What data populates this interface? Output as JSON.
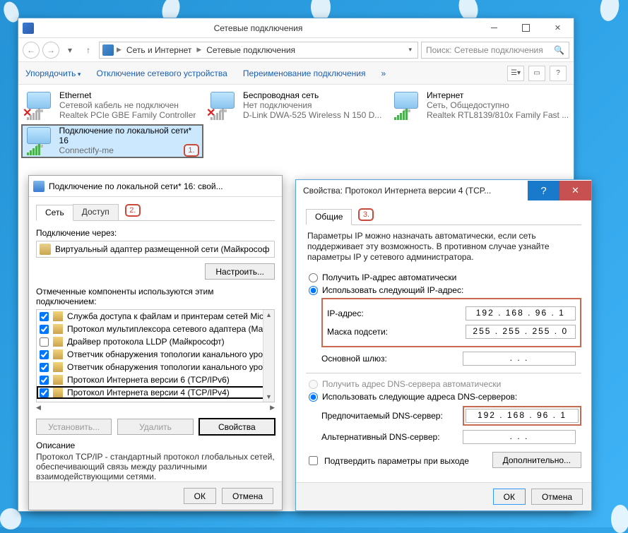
{
  "main": {
    "title": "Сетевые подключения",
    "breadcrumb": {
      "seg1": "Сеть и Интернет",
      "seg2": "Сетевые подключения"
    },
    "search_placeholder": "Поиск: Сетевые подключения",
    "toolbar": {
      "organize": "Упорядочить",
      "disable": "Отключение сетевого устройства",
      "rename": "Переименование подключения"
    },
    "connections": [
      {
        "name": "Ethernet",
        "status": "Сетевой кабель не подключен",
        "device": "Realtek PCIe GBE Family Controller",
        "disconnected": true
      },
      {
        "name": "Беспроводная сеть",
        "status": "Нет подключения",
        "device": "D-Link DWA-525 Wireless N 150 D...",
        "disconnected": true
      },
      {
        "name": "Интернет",
        "status": "Сеть, Общедоступно",
        "device": "Realtek RTL8139/810x Family Fast ...",
        "disconnected": false
      },
      {
        "name": "Подключение по локальной сети* 16",
        "status": "",
        "device": "Connectify-me",
        "disconnected": false,
        "selected": true
      }
    ]
  },
  "props": {
    "title": "Подключение по локальной сети* 16: свой...",
    "tabs": {
      "net": "Сеть",
      "access": "Доступ"
    },
    "connect_via_label": "Подключение через:",
    "adapter": "Виртуальный адаптер размещенной сети (Майкрософ",
    "configure": "Настроить...",
    "components_label": "Отмеченные компоненты используются этим подключением:",
    "components": [
      {
        "label": "Служба доступа к файлам и принтерам сетей Micro",
        "checked": true
      },
      {
        "label": "Протокол мультиплексора сетевого адаптера (Ма",
        "checked": true
      },
      {
        "label": "Драйвер протокола LLDP (Майкрософт)",
        "checked": false
      },
      {
        "label": "Ответчик обнаружения топологии канального уро",
        "checked": true
      },
      {
        "label": "Ответчик обнаружения топологии канального уро",
        "checked": true
      },
      {
        "label": "Протокол Интернета версии 6 (TCP/IPv6)",
        "checked": true
      },
      {
        "label": "Протокол Интернета версии 4 (TCP/IPv4)",
        "checked": true,
        "highlight": true
      }
    ],
    "buttons": {
      "install": "Установить...",
      "remove": "Удалить",
      "properties": "Свойства"
    },
    "desc_header": "Описание",
    "desc_text": "Протокол TCP/IP - стандартный протокол глобальных сетей, обеспечивающий связь между различными взаимодействующими сетями.",
    "ok": "ОК",
    "cancel": "Отмена"
  },
  "ip": {
    "title": "Свойства: Протокол Интернета версии 4 (TCP...",
    "tab_general": "Общие",
    "intro": "Параметры IP можно назначать автоматически, если сеть поддерживает эту возможность. В противном случае узнайте параметры IP у сетевого администратора.",
    "opt_ip_auto": "Получить IP-адрес автоматически",
    "opt_ip_manual": "Использовать следующий IP-адрес:",
    "opt_dns_auto": "Получить адрес DNS-сервера автоматически",
    "opt_dns_manual": "Использовать следующие адреса DNS-серверов:",
    "labels": {
      "ip": "IP-адрес:",
      "mask": "Маска подсети:",
      "gateway": "Основной шлюз:",
      "dns1": "Предпочитаемый DNS-сервер:",
      "dns2": "Альтернативный DNS-сервер:"
    },
    "values": {
      "ip": "192 . 168 . 96 .  1",
      "mask": "255 . 255 . 255 .  0",
      "gateway": ".       .       .",
      "dns1": "192 . 168 . 96 .  1",
      "dns2": ".       .       ."
    },
    "confirm_on_exit": "Подтвердить параметры при выходе",
    "advanced": "Дополнительно...",
    "ok": "ОК",
    "cancel": "Отмена"
  },
  "annotations": {
    "a1": "1.",
    "a2": "2.",
    "a3": "3."
  }
}
